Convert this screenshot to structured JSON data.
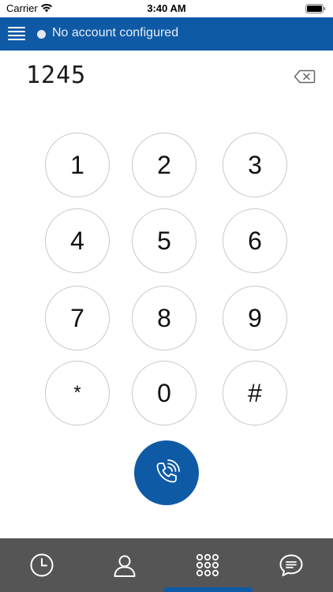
{
  "status_bar": {
    "carrier": "Carrier",
    "time": "3:40 AM",
    "icons": [
      "wifi-icon",
      "battery-icon"
    ]
  },
  "header": {
    "menu_icon": "hamburger-menu-icon",
    "account_status": "No account configured",
    "status_dot_color": "#e6e9ee",
    "background_color": "#0f5aa5"
  },
  "dialer": {
    "number": "1245",
    "backspace_icon": "backspace-icon"
  },
  "keypad": {
    "keys": [
      "1",
      "2",
      "3",
      "4",
      "5",
      "6",
      "7",
      "8",
      "9",
      "*",
      "0",
      "#"
    ]
  },
  "call_button": {
    "icon": "phone-call-icon",
    "color": "#0f5aa5"
  },
  "tab_bar": {
    "background_color": "#555555",
    "active_tab": "keypad",
    "tabs": [
      {
        "id": "recents",
        "icon": "clock-icon"
      },
      {
        "id": "contacts",
        "icon": "person-icon"
      },
      {
        "id": "keypad",
        "icon": "keypad-grid-icon"
      },
      {
        "id": "messages",
        "icon": "chat-bubble-icon"
      }
    ]
  }
}
